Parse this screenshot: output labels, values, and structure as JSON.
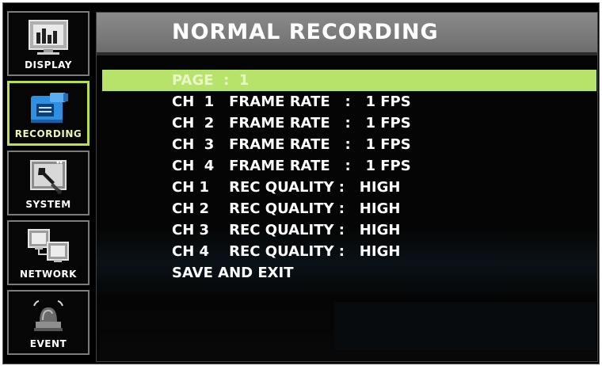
{
  "sidebar": {
    "items": [
      {
        "label": "DISPLAY",
        "icon": "display-icon",
        "active": false
      },
      {
        "label": "RECORDING",
        "icon": "camcorder-icon",
        "active": true
      },
      {
        "label": "SYSTEM",
        "icon": "wrench-icon",
        "active": false
      },
      {
        "label": "NETWORK",
        "icon": "network-icon",
        "active": false
      },
      {
        "label": "EVENT",
        "icon": "alarm-light-icon",
        "active": false
      }
    ]
  },
  "main": {
    "title": "NORMAL  RECORDING",
    "menu": [
      "PAGE  :  1",
      "CH  1   FRAME RATE   :   1 FPS",
      "CH  2   FRAME RATE   :   1 FPS",
      "CH  3   FRAME RATE   :   1 FPS",
      "CH  4   FRAME RATE   :   1 FPS",
      "CH 1    REC QUALITY :   HIGH",
      "CH 2    REC QUALITY :   HIGH",
      "CH 3    REC QUALITY :   HIGH",
      "CH 4    REC QUALITY :   HIGH",
      "SAVE AND EXIT"
    ],
    "selected_index": 0
  },
  "colors": {
    "highlight": "#b7e36b",
    "active_border": "#b8e04c",
    "title_bar": "#7a7a7a"
  }
}
